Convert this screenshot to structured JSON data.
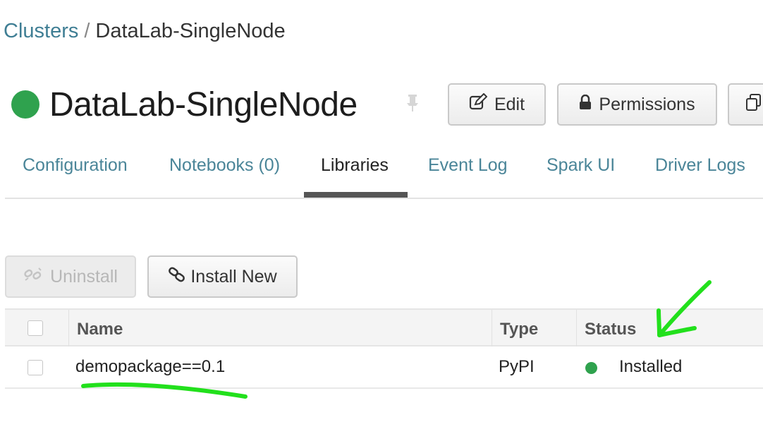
{
  "breadcrumb": {
    "root": "Clusters",
    "separator": "/",
    "current": "DataLab-SingleNode"
  },
  "cluster": {
    "name": "DataLab-SingleNode",
    "status_color": "#2fa24e"
  },
  "header_buttons": {
    "edit": "Edit",
    "permissions": "Permissions"
  },
  "icons": {
    "edit": "pencil-square-icon",
    "lock": "lock-icon",
    "pin": "pin-icon",
    "clone": "copy-icon",
    "link": "link-icon",
    "unlink": "broken-link-icon"
  },
  "tabs": [
    {
      "label": "Configuration"
    },
    {
      "label": "Notebooks (0)"
    },
    {
      "label": "Libraries"
    },
    {
      "label": "Event Log"
    },
    {
      "label": "Spark UI"
    },
    {
      "label": "Driver Logs"
    }
  ],
  "active_tab": "Libraries",
  "library_actions": {
    "uninstall": "Uninstall",
    "install_new": "Install New"
  },
  "table": {
    "headers": {
      "name": "Name",
      "type": "Type",
      "status": "Status"
    },
    "rows": [
      {
        "name": "demopackage==0.1",
        "type": "PyPI",
        "status": "Installed",
        "status_color": "#2fa24e"
      }
    ]
  },
  "colors": {
    "link": "#3f7e94",
    "tab": "#4a8598",
    "annotation": "#22e01c"
  }
}
